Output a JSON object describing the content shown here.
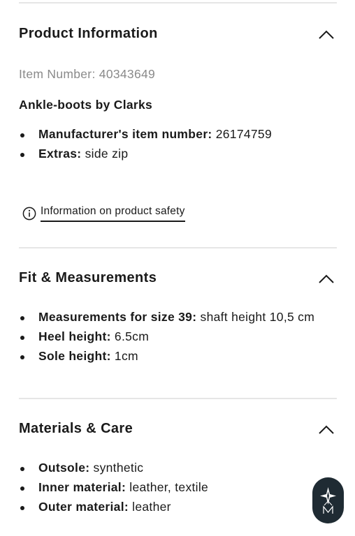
{
  "product_info": {
    "title": "Product Information",
    "item_number_label": "Item Number:",
    "item_number_value": "40343649",
    "product_name": "Ankle-boots by Clarks",
    "attributes": [
      {
        "label": "Manufacturer's item number:",
        "value": "26174759"
      },
      {
        "label": "Extras:",
        "value": "side zip"
      }
    ],
    "safety_link": "Information on product safety",
    "chevron_icon": "chevron-up-icon",
    "info_icon": "info-circle-icon"
  },
  "fit": {
    "title": "Fit & Measurements",
    "attributes": [
      {
        "label": "Measurements for size 39:",
        "value": "shaft height 10,5 cm"
      },
      {
        "label": "Heel height:",
        "value": "6.5cm"
      },
      {
        "label": "Sole height:",
        "value": "1cm"
      }
    ],
    "chevron_icon": "chevron-up-icon"
  },
  "materials": {
    "title": "Materials & Care",
    "attributes": [
      {
        "label": "Outsole:",
        "value": "synthetic"
      },
      {
        "label": "Inner material:",
        "value": "leather, textile"
      },
      {
        "label": "Outer material:",
        "value": "leather"
      }
    ],
    "chevron_icon": "chevron-up-icon"
  },
  "floating_button": {
    "icon": "assistant-logo-icon",
    "background": "#1f2b33"
  },
  "colors": {
    "text": "#1a1a1a",
    "muted": "#8a8a8a",
    "divider": "#e6e6e6"
  }
}
